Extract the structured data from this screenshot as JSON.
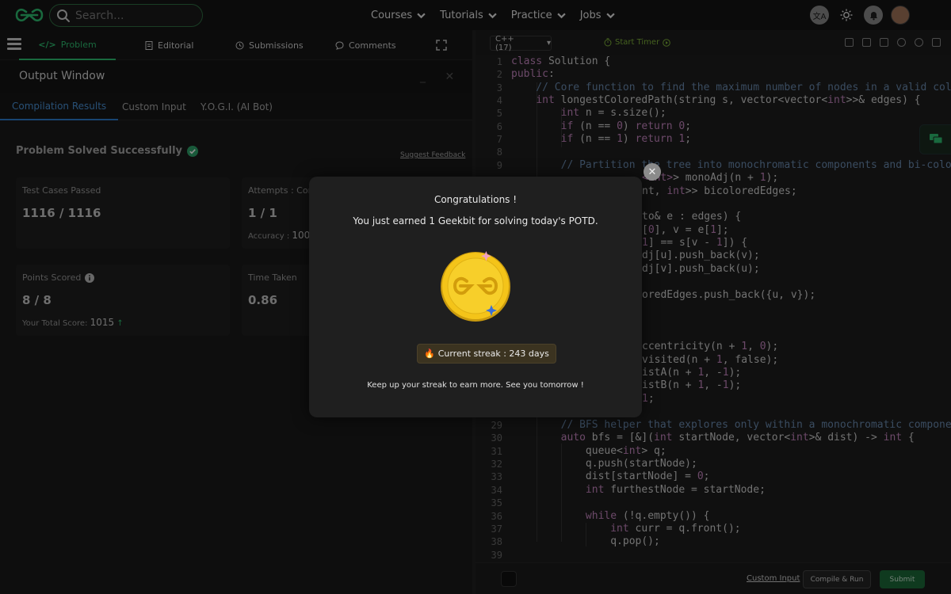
{
  "search": {
    "placeholder": "Search..."
  },
  "nav": {
    "items": [
      "Courses",
      "Tutorials",
      "Practice",
      "Jobs"
    ]
  },
  "problem_tabs": [
    "Problem",
    "Editorial",
    "Submissions",
    "Comments"
  ],
  "output": {
    "title": "Output Window",
    "tabs": [
      "Compilation Results",
      "Custom Input",
      "Y.O.G.I. (AI Bot)"
    ],
    "status": "Problem Solved Successfully",
    "feedback_link": "Suggest Feedback",
    "cards": {
      "test_cases": {
        "label": "Test Cases Passed",
        "value": "1116 / 1116"
      },
      "attempts": {
        "label": "Attempts : Corr",
        "value": "1 / 1",
        "sub_label": "Accuracy :",
        "sub_value": "100"
      },
      "points": {
        "label": "Points Scored",
        "value": "8 / 8",
        "sub_label": "Your Total Score:",
        "sub_value": "1015"
      },
      "time": {
        "label": "Time Taken",
        "value": "0.86"
      }
    }
  },
  "editor": {
    "language": "C++ (17)",
    "timer": "Start Timer",
    "custom_input": "Custom Input",
    "compile_run": "Compile & Run",
    "submit": "Submit"
  },
  "modal": {
    "title": "Congratulations !",
    "message": "You just earned 1 Geekbit for solving today's POTD.",
    "streak": "Current streak : 243 days",
    "footer": "Keep up your streak to earn more. See you tomorrow !"
  },
  "colors": {
    "accent_green": "#2fbf71",
    "link_blue": "#4a93d8",
    "coin_gold": "#f2c21b"
  }
}
